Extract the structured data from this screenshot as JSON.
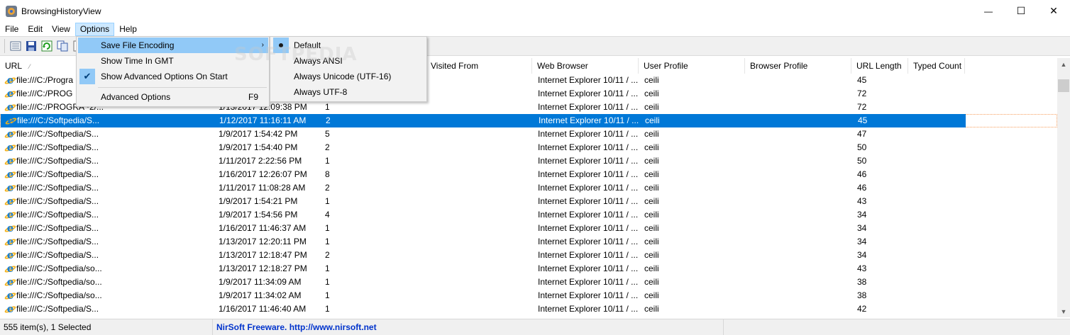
{
  "window": {
    "title": "BrowsingHistoryView",
    "minimize_glyph": "—",
    "maximize_glyph": "☐",
    "close_glyph": "✕"
  },
  "menubar": {
    "items": [
      "File",
      "Edit",
      "View",
      "Options",
      "Help"
    ]
  },
  "toolbar": {
    "icons": [
      "properties-icon",
      "save-icon",
      "refresh-icon",
      "copy-icon",
      "html-report-icon"
    ]
  },
  "options_menu": {
    "items": [
      {
        "label": "Save File Encoding",
        "submenu_arrow": "›"
      },
      {
        "label": "Show Time In GMT"
      },
      {
        "label": "Show Advanced Options On Start",
        "check": "✔"
      },
      {
        "label": "Advanced Options",
        "shortcut": "F9"
      }
    ]
  },
  "encoding_submenu": {
    "items": [
      "Default",
      "Always ANSI",
      "Always Unicode (UTF-16)",
      "Always UTF-8"
    ],
    "selected": "Default"
  },
  "watermark": "SOFTPEDIA",
  "list": {
    "columns": [
      "URL",
      "",
      "",
      "Visited From",
      "Web Browser",
      "User Profile",
      "Browser Profile",
      "URL Length",
      "Typed Count"
    ],
    "sort_indicator": "⁄",
    "rows": [
      {
        "url": "file:///C:/Progra",
        "time": "",
        "count": "",
        "browser": "Internet Explorer 10/11 / ...",
        "user": "ceili",
        "length": "45"
      },
      {
        "url": "file:///C:/PROG",
        "time": "",
        "count": "",
        "browser": "Internet Explorer 10/11 / ...",
        "user": "ceili",
        "length": "72"
      },
      {
        "url": "file:///C:/PROGRA~2/...",
        "time": "1/13/2017 12:09:38 PM",
        "count": "1",
        "browser": "Internet Explorer 10/11 / ...",
        "user": "ceili",
        "length": "72"
      },
      {
        "url": "file:///C:/Softpedia/S...",
        "time": "1/12/2017 11:16:11 AM",
        "count": "2",
        "browser": "Internet Explorer 10/11 / ...",
        "user": "ceili",
        "length": "45",
        "selected": true
      },
      {
        "url": "file:///C:/Softpedia/S...",
        "time": "1/9/2017 1:54:42 PM",
        "count": "5",
        "browser": "Internet Explorer 10/11 / ...",
        "user": "ceili",
        "length": "47"
      },
      {
        "url": "file:///C:/Softpedia/S...",
        "time": "1/9/2017 1:54:40 PM",
        "count": "2",
        "browser": "Internet Explorer 10/11 / ...",
        "user": "ceili",
        "length": "50"
      },
      {
        "url": "file:///C:/Softpedia/S...",
        "time": "1/11/2017 2:22:56 PM",
        "count": "1",
        "browser": "Internet Explorer 10/11 / ...",
        "user": "ceili",
        "length": "50"
      },
      {
        "url": "file:///C:/Softpedia/S...",
        "time": "1/16/2017 12:26:07 PM",
        "count": "8",
        "browser": "Internet Explorer 10/11 / ...",
        "user": "ceili",
        "length": "46"
      },
      {
        "url": "file:///C:/Softpedia/S...",
        "time": "1/11/2017 11:08:28 AM",
        "count": "2",
        "browser": "Internet Explorer 10/11 / ...",
        "user": "ceili",
        "length": "46"
      },
      {
        "url": "file:///C:/Softpedia/S...",
        "time": "1/9/2017 1:54:21 PM",
        "count": "1",
        "browser": "Internet Explorer 10/11 / ...",
        "user": "ceili",
        "length": "43"
      },
      {
        "url": "file:///C:/Softpedia/S...",
        "time": "1/9/2017 1:54:56 PM",
        "count": "4",
        "browser": "Internet Explorer 10/11 / ...",
        "user": "ceili",
        "length": "34"
      },
      {
        "url": "file:///C:/Softpedia/S...",
        "time": "1/16/2017 11:46:37 AM",
        "count": "1",
        "browser": "Internet Explorer 10/11 / ...",
        "user": "ceili",
        "length": "34"
      },
      {
        "url": "file:///C:/Softpedia/S...",
        "time": "1/13/2017 12:20:11 PM",
        "count": "1",
        "browser": "Internet Explorer 10/11 / ...",
        "user": "ceili",
        "length": "34"
      },
      {
        "url": "file:///C:/Softpedia/S...",
        "time": "1/13/2017 12:18:47 PM",
        "count": "2",
        "browser": "Internet Explorer 10/11 / ...",
        "user": "ceili",
        "length": "34"
      },
      {
        "url": "file:///C:/Softpedia/so...",
        "time": "1/13/2017 12:18:27 PM",
        "count": "1",
        "browser": "Internet Explorer 10/11 / ...",
        "user": "ceili",
        "length": "43"
      },
      {
        "url": "file:///C:/Softpedia/so...",
        "time": "1/9/2017 11:34:09 AM",
        "count": "1",
        "browser": "Internet Explorer 10/11 / ...",
        "user": "ceili",
        "length": "38"
      },
      {
        "url": "file:///C:/Softpedia/so...",
        "time": "1/9/2017 11:34:02 AM",
        "count": "1",
        "browser": "Internet Explorer 10/11 / ...",
        "user": "ceili",
        "length": "38"
      },
      {
        "url": "file:///C:/Softpedia/S...",
        "time": "1/16/2017 11:46:40 AM",
        "count": "1",
        "browser": "Internet Explorer 10/11 / ...",
        "user": "ceili",
        "length": "42"
      }
    ]
  },
  "statusbar": {
    "count_text": "555 item(s), 1 Selected",
    "link_text": "NirSoft Freeware.  http://www.nirsoft.net"
  },
  "colors": {
    "selection": "#0078d7",
    "menu_highlight": "#91c9f7",
    "link": "#0033cc"
  }
}
